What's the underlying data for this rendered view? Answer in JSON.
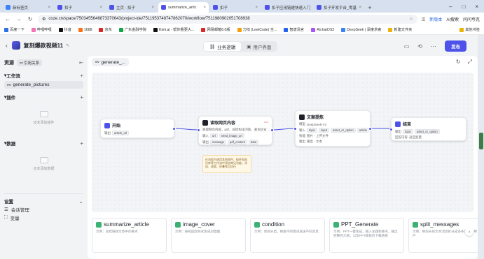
{
  "browser": {
    "tabs": [
      {
        "label": "新标签页",
        "color": "#3b82f6"
      },
      {
        "label": "扣子",
        "color": "#4d53e8"
      },
      {
        "label": "主页 - 扣子",
        "color": "#4d53e8"
      },
      {
        "label": "summarize_artic",
        "color": "#4d53e8"
      },
      {
        "label": "扣子",
        "color": "#4d53e8"
      },
      {
        "label": "扣子应用链建快速入门",
        "color": "#4d53e8"
      },
      {
        "label": "扣子开发平台_零基",
        "color": "#4d53e8"
      }
    ],
    "url": "coze.cn/space/7503455646873370643/project-ide/7511953748747862070/workflow/7511980902051708938",
    "new_version": "新版本",
    "ai_search": "AI搜索",
    "ask": "问问夸克",
    "bookmarks": [
      "百度一下",
      "哔哩哔哩",
      "抖音",
      "1688",
      "京东",
      "广东金融学院",
      "Kimi.ai - 帮你看更大...",
      "网易邮箱6.0版",
      "力扣 (LeetCode) 全...",
      "智谱清言",
      "AIchatOS2",
      "DeepSeek | 深度求索",
      "新建文件夹",
      "其他书签"
    ]
  },
  "app": {
    "project_title": "复刻爆款视频11",
    "segments": [
      "业务逻辑",
      "用户界面"
    ],
    "publish": "发布"
  },
  "sidebar": {
    "resources": "资源",
    "references": "引用关系",
    "workflow": "工作流",
    "workflow_items": [
      "generate_pictures"
    ],
    "plugins": "插件",
    "plugins_empty": "还未添加插件",
    "data": "数据",
    "data_empty": "还未添加数据",
    "settings": "设置",
    "settings_items": [
      "会话管理",
      "变量"
    ]
  },
  "canvas": {
    "tab": "generate_...",
    "nodes": {
      "start": {
        "title": "开始",
        "out_label": "输出",
        "tags": [
          "article_url"
        ]
      },
      "read": {
        "title": "读取网页内容",
        "desc": "获取网页内容，pdf、非结构化内容，查询企业 ...",
        "in_label": "输入",
        "in_tags": [
          "url",
          "need_image_url"
        ],
        "out_label": "输出",
        "out_tags": [
          "message",
          "pdf_content",
          "data"
        ]
      },
      "text": {
        "title": "文案提炼",
        "model": "DeepSeek-V3",
        "in_label": "输入",
        "in_tags": [
          "topic",
          "input",
          "asset_or_option",
          "article"
        ],
        "skill_label": "技能",
        "skill": "图片 - 上传文件",
        "out_label": "输出",
        "out_tags": [
          "输出 - 文本"
        ]
      },
      "end": {
        "title": "结束",
        "in_label": "输出",
        "in_tags": [
          "topic",
          "asset_or_option"
        ],
        "reply_label": "回答内容",
        "reply": "返回变量"
      }
    },
    "note": "在流程内调用其他插件、插件和知识库等工作流中添加常见功能，添加、收缩、折叠等后执行"
  },
  "templates": [
    {
      "name": "summarize_article",
      "desc": "示例：总结链接文章中的要点"
    },
    {
      "name": "image_cover",
      "desc": "示例：按照固定样式生成封面图"
    },
    {
      "name": "condition",
      "desc": "示例：新闻分类，根据不同情况发送不同消息"
    },
    {
      "name": "PPT_Generate",
      "desc": "示例：PPT一键生成，输入主题和要点，输出完整的大纲，以及PPT模板的下载链接"
    },
    {
      "name": "split_messages",
      "desc": "示例：把较长的文本消息拆分成多条发送给用户"
    }
  ]
}
